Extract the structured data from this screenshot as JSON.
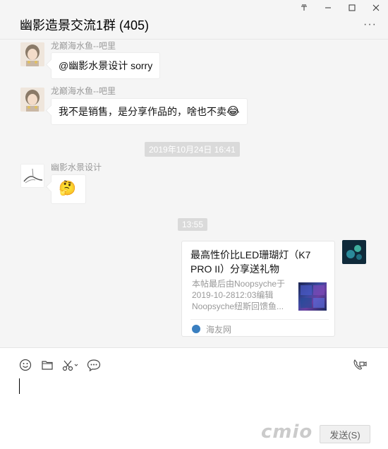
{
  "window": {
    "title": "幽影造景交流1群 (405)",
    "controls": {
      "pin": "푸",
      "minimize": "—",
      "maximize": "☐",
      "close": "✕"
    },
    "more": "···"
  },
  "messages": [
    {
      "sender": "龙巅海水鱼--吧里",
      "text": "@幽影水景设计 sorry"
    },
    {
      "sender": "龙巅海水鱼--吧里",
      "text": "我不是销售，是分享作品的，啥也不卖"
    },
    {
      "timestamp": "2019年10月24日 16:41"
    },
    {
      "sender": "幽影水景设计",
      "emoji": "🤔"
    },
    {
      "timestamp": "13:55"
    }
  ],
  "card": {
    "title": "最高性价比LED珊瑚灯（K7 PRO II）分享送礼物",
    "desc_lines": [
      "本帖最后由Noopsyche于",
      "2019-10-2812:03编辑",
      "Noopsyche纽斯回馈鱼..."
    ],
    "source": "海友网"
  },
  "composer": {
    "tools": [
      "emoji-icon",
      "folder-icon",
      "scissors-icon",
      "chat-icon",
      "video-call-icon"
    ],
    "send_label": "发送(S)",
    "watermark": "cmio"
  },
  "emoji_laugh": "😂",
  "colors": {
    "background": "#f5f5f5",
    "bubble": "#ffffff",
    "timestamp_bg": "#dadada"
  }
}
